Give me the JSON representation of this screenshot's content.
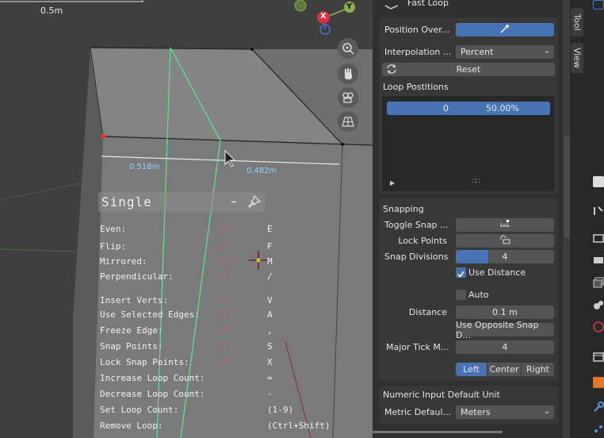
{
  "viewport": {
    "scale_label": "0.5m",
    "axis": {
      "x": "X",
      "y": "Y"
    },
    "distance_left": "0.518m",
    "distance_right": "0.482m"
  },
  "hud": {
    "title": "Single",
    "minimize": "–",
    "rows": [
      {
        "label": "Even:",
        "value": "OFF",
        "key": "E"
      },
      {
        "label": "Flip:",
        "value": "OFF",
        "key": "F"
      },
      {
        "label": "Mirrored:",
        "value": "OFF",
        "key": "M"
      },
      {
        "label": "Perpendicular:",
        "value": "OFF",
        "key": "/"
      },
      {
        "label": "Insert Verts:",
        "value": "OFF",
        "key": "V"
      },
      {
        "label": "Use Selected Edges:",
        "value": "OFF",
        "key": "A"
      },
      {
        "label": "Freeze Edge:",
        "value": "OFF",
        "key": ","
      },
      {
        "label": "Snap Points:",
        "value": "OFF",
        "key": "S"
      },
      {
        "label": "Lock Snap Points:",
        "value": "OFF",
        "key": "X"
      },
      {
        "label": "Increase Loop Count:",
        "value": "",
        "key": "="
      },
      {
        "label": "Decrease Loop Count:",
        "value": "",
        "key": "-"
      },
      {
        "label": "Set Loop Count:",
        "value": "",
        "key": "(1-9)"
      },
      {
        "label": "Remove Loop:",
        "value": "",
        "key": "(Ctrl+Shift)"
      }
    ]
  },
  "panel": {
    "header": "Fast Loop",
    "position_override_label": "Position Over...",
    "interpolation_label": "Interpolation ...",
    "interpolation_value": "Percent",
    "reset_label": "Reset",
    "loop_positions_label": "Loop Postitions",
    "loop_item_index": "0",
    "loop_item_value": "50.00%",
    "snapping": {
      "title": "Snapping",
      "toggle_snap_label": "Toggle Snap ...",
      "lock_points_label": "Lock Points",
      "snap_divisions_label": "Snap Divisions",
      "snap_divisions_value": "4",
      "snap_divisions_fill": 0.33,
      "use_distance_label": "Use Distance",
      "use_distance_checked": true,
      "auto_label": "Auto",
      "auto_checked": false,
      "distance_label": "Distance",
      "distance_value": "0.1 m",
      "use_opposite_label": "Use Opposite Snap D...",
      "major_tick_label": "Major Tick M...",
      "major_tick_value": "4",
      "align_options": [
        "Left",
        "Center",
        "Right"
      ],
      "align_selected": "Left"
    },
    "numeric": {
      "title": "Numeric Input Default Unit",
      "metric_label": "Metric Defaul...",
      "metric_value": "Meters"
    }
  },
  "tabs": [
    "Tool",
    "View"
  ],
  "colors": {
    "accent": "#4772b3",
    "green_loop": "#5ee08a",
    "off_red": "#e06a6a"
  }
}
